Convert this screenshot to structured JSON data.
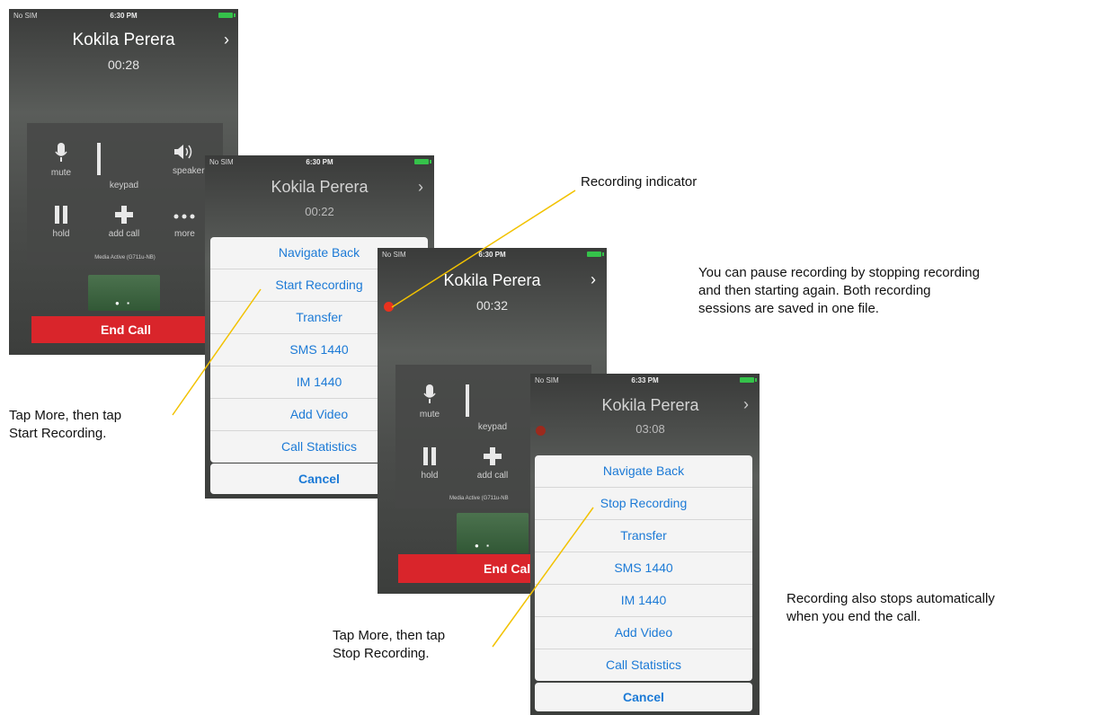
{
  "colors": {
    "accent": "#1c7ad6",
    "end_call": "#d9252b",
    "recording_dot": "#e8321e",
    "callout_line": "#f2c200"
  },
  "phone1": {
    "status": {
      "carrier": "No SIM",
      "time": "6:30 PM"
    },
    "contact": "Kokila Perera",
    "timer": "00:28",
    "controls": [
      {
        "label": "mute",
        "icon": "microphone-icon"
      },
      {
        "label": "keypad",
        "icon": "keypad-icon"
      },
      {
        "label": "speaker",
        "icon": "speaker-icon"
      },
      {
        "label": "hold",
        "icon": "pause-icon"
      },
      {
        "label": "add call",
        "icon": "plus-icon"
      },
      {
        "label": "more",
        "icon": "ellipsis-icon"
      }
    ],
    "media_status": "Media Active (G711u-NB)",
    "end_call_label": "End Call"
  },
  "phone2": {
    "status": {
      "carrier": "No SIM",
      "time": "6:30 PM"
    },
    "contact": "Kokila Perera",
    "timer": "00:22",
    "menu": [
      "Navigate Back",
      "Start Recording",
      "Transfer",
      "SMS 1440",
      "IM 1440",
      "Add Video",
      "Call Statistics"
    ],
    "cancel_label": "Cancel"
  },
  "phone3": {
    "status": {
      "carrier": "No SIM",
      "time": "6:30 PM"
    },
    "contact": "Kokila Perera",
    "timer": "00:32",
    "controls": [
      {
        "label": "mute",
        "icon": "microphone-icon"
      },
      {
        "label": "keypad",
        "icon": "keypad-icon"
      },
      {
        "label": "hold",
        "icon": "pause-icon"
      },
      {
        "label": "add call",
        "icon": "plus-icon"
      }
    ],
    "media_status": "Media Active (G711u-NB",
    "end_call_label": "End Call"
  },
  "phone4": {
    "status": {
      "carrier": "No SIM",
      "time": "6:33 PM"
    },
    "contact": "Kokila Perera",
    "timer": "03:08",
    "menu": [
      "Navigate Back",
      "Stop Recording",
      "Transfer",
      "SMS 1440",
      "IM 1440",
      "Add Video",
      "Call Statistics"
    ],
    "cancel_label": "Cancel"
  },
  "annotations": {
    "recording_indicator": "Recording indicator",
    "tap_start": [
      "Tap More, then tap",
      "Start Recording."
    ],
    "tap_stop": [
      "Tap More, then tap",
      "Stop Recording."
    ],
    "pause_note": [
      "You can pause recording by stopping recording",
      "and then starting again. Both recording",
      "sessions are saved in one file."
    ],
    "auto_stop_note": [
      "Recording also stops automatically",
      "when you end the call."
    ]
  }
}
